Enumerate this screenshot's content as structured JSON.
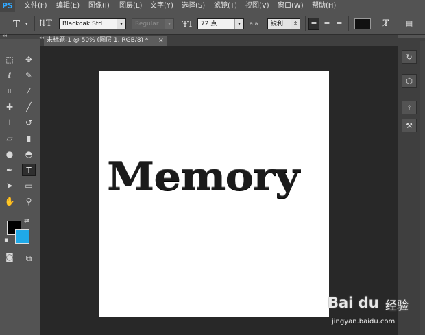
{
  "app": {
    "logo": "PS"
  },
  "menu": [
    "文件(F)",
    "编辑(E)",
    "图像(I)",
    "图层(L)",
    "文字(Y)",
    "选择(S)",
    "滤镜(T)",
    "视图(V)",
    "窗口(W)",
    "帮助(H)"
  ],
  "options": {
    "tool_glyph": "T",
    "font_family": "Blackoak Std",
    "font_style": "Regular",
    "font_size": "72 点",
    "aa_glyph": "a a",
    "antialias": "锐利",
    "text_color": "#111111"
  },
  "document": {
    "tab_title": "未标题-1 @ 50% (图层 1, RGB/8) *",
    "close_glyph": "×",
    "text": "Memory",
    "canvas_color": "#ffffff"
  },
  "tools": [
    [
      "marquee-icon",
      "⬚"
    ],
    [
      "move-icon",
      "✥"
    ],
    [
      "lasso-icon",
      "ℓ"
    ],
    [
      "quick-select-icon",
      "✎"
    ],
    [
      "crop-icon",
      "⌗"
    ],
    [
      "eyedropper-icon",
      "⁄"
    ],
    [
      "healing-brush-icon",
      "✚"
    ],
    [
      "brush-icon",
      "╱"
    ],
    [
      "stamp-icon",
      "⊥"
    ],
    [
      "history-brush-icon",
      "↺"
    ],
    [
      "eraser-icon",
      "▱"
    ],
    [
      "gradient-icon",
      "▮"
    ],
    [
      "blur-icon",
      "●"
    ],
    [
      "dodge-icon",
      "◓"
    ],
    [
      "pen-icon",
      "✒"
    ],
    [
      "type-icon",
      "T"
    ],
    [
      "path-select-icon",
      "➤"
    ],
    [
      "rectangle-icon",
      "▭"
    ],
    [
      "hand-icon",
      "✋"
    ],
    [
      "zoom-icon",
      "⚲"
    ]
  ],
  "colors": {
    "foreground": "#000000",
    "background": "#1fa9e8"
  },
  "watermark": {
    "logo": "Bai du",
    "cn": "经验",
    "url": "jingyan.baidu.com"
  }
}
